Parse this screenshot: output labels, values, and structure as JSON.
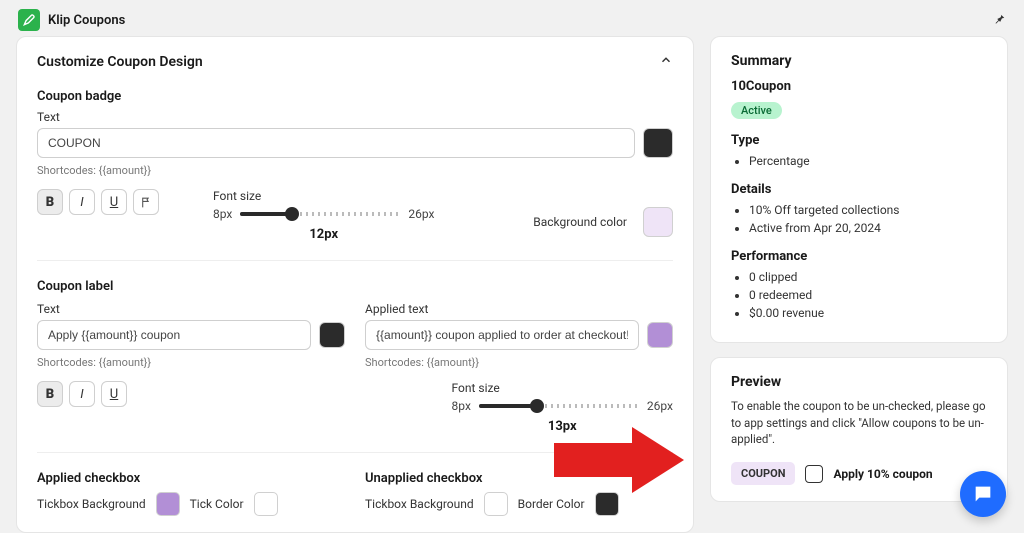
{
  "app": {
    "title": "Klip Coupons"
  },
  "main": {
    "header": "Customize Coupon Design",
    "badge": {
      "title": "Coupon badge",
      "text_label": "Text",
      "text_value": "COUPON",
      "shortcodes": "Shortcodes: {{amount}}",
      "font_size_label": "Font size",
      "font_min": "8px",
      "font_max": "26px",
      "font_value": "12px",
      "bg_label": "Background color",
      "swatch_color": "#2b2b2b",
      "bg_color": "#efe4f7"
    },
    "label": {
      "title": "Coupon label",
      "text_label": "Text",
      "text_value": "Apply {{amount}} coupon",
      "swatch_color": "#2b2b2b",
      "applied_label": "Applied text",
      "applied_value": "{{amount}} coupon applied to order at checkout!",
      "applied_swatch": "#b28fd6",
      "shortcodes": "Shortcodes: {{amount}}",
      "applied_shortcodes": "Shortcodes: {{amount}}",
      "font_size_label": "Font size",
      "font_min": "8px",
      "font_max": "26px",
      "font_value": "13px"
    },
    "applied_cb": {
      "title": "Applied checkbox",
      "tick_bg_label": "Tickbox Background",
      "tick_bg_color": "#b28fd6",
      "tick_color_label": "Tick Color",
      "tick_color": "#ffffff"
    },
    "unapplied_cb": {
      "title": "Unapplied checkbox",
      "tick_bg_label": "Tickbox Background",
      "tick_bg_color": "#ffffff",
      "border_label": "Border Color",
      "border_color": "#2b2b2b"
    }
  },
  "summary": {
    "title": "Summary",
    "name": "10Coupon",
    "status": "Active",
    "type_h": "Type",
    "type_items": [
      "Percentage"
    ],
    "details_h": "Details",
    "details_items": [
      "10% Off targeted collections",
      "Active from Apr 20, 2024"
    ],
    "perf_h": "Performance",
    "perf_items": [
      "0 clipped",
      "0 redeemed",
      "$0.00 revenue"
    ]
  },
  "preview": {
    "title": "Preview",
    "note": "To enable the coupon to be un-checked, please go to app settings and click \"Allow coupons to be un-applied\".",
    "chip": "COUPON",
    "label": "Apply 10% coupon"
  }
}
